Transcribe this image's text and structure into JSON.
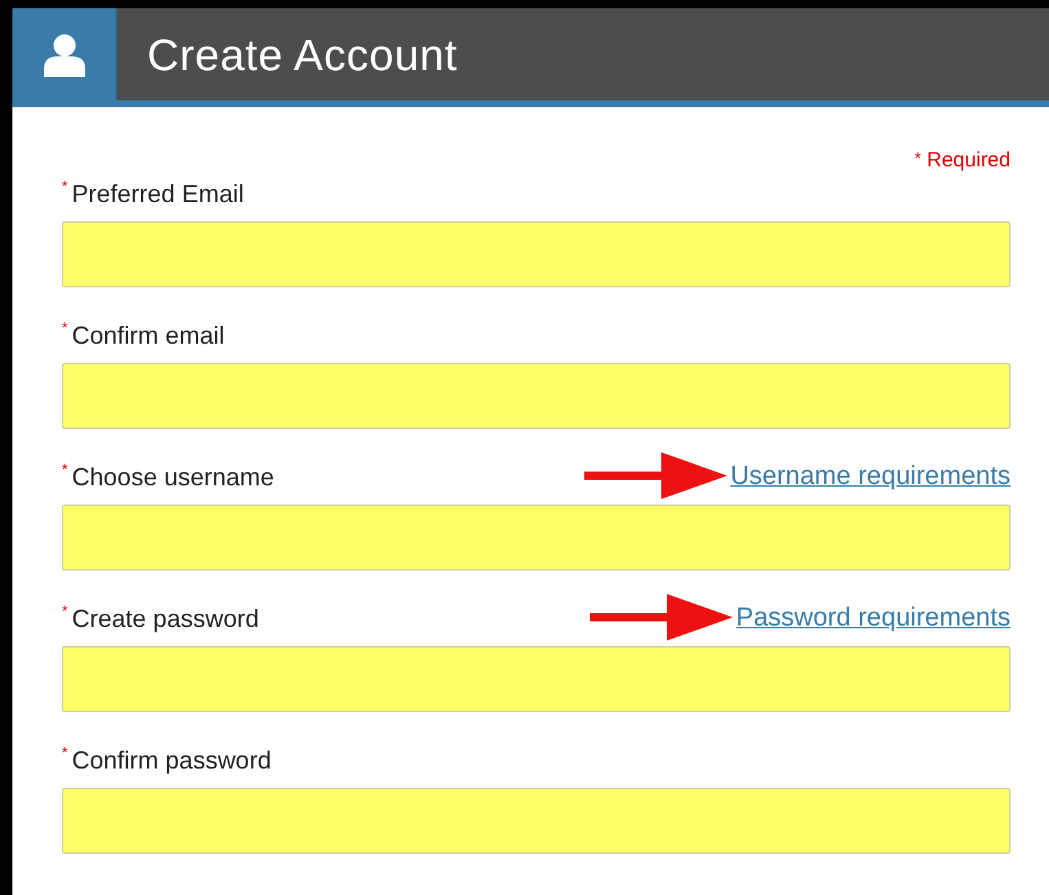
{
  "header": {
    "title": "Create Account"
  },
  "required_note": {
    "mark": "*",
    "text": "Required"
  },
  "fields": [
    {
      "mark": "*",
      "label": "Preferred Email",
      "arrow": false
    },
    {
      "mark": "*",
      "label": "Confirm email",
      "arrow": false
    },
    {
      "mark": "*",
      "label": "Choose username",
      "link": "Username requirements",
      "arrow": true
    },
    {
      "mark": "*",
      "label": "Create password",
      "link": "Password requirements",
      "arrow": true
    },
    {
      "mark": "*",
      "label": "Confirm password",
      "arrow": false
    }
  ]
}
